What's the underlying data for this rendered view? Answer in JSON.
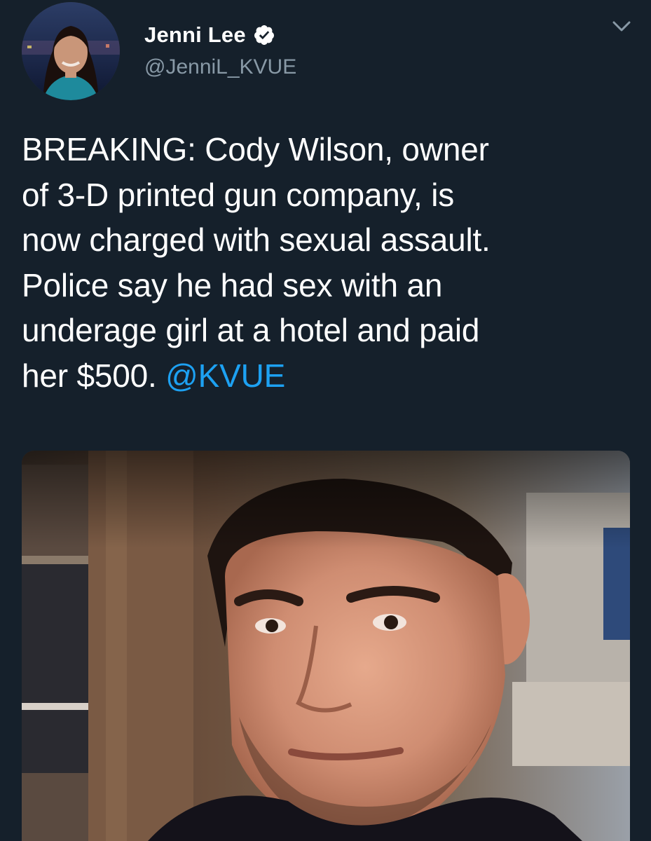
{
  "tweet": {
    "author": {
      "display_name": "Jenni Lee",
      "handle": "@JenniL_KVUE",
      "verified": true
    },
    "text_lines": [
      "BREAKING: Cody Wilson, owner",
      "of 3-D printed gun company, is",
      "now charged with sexual assault.",
      "Police say he had sex with an",
      "underage girl at a hotel and paid",
      "her $500. "
    ],
    "mention": "@KVUE",
    "icons": {
      "verified": "verified-badge-icon",
      "menu": "chevron-down-icon"
    },
    "colors": {
      "background": "#15202b",
      "text": "#ffffff",
      "secondary_text": "#8899a6",
      "link": "#1da1f2"
    }
  }
}
